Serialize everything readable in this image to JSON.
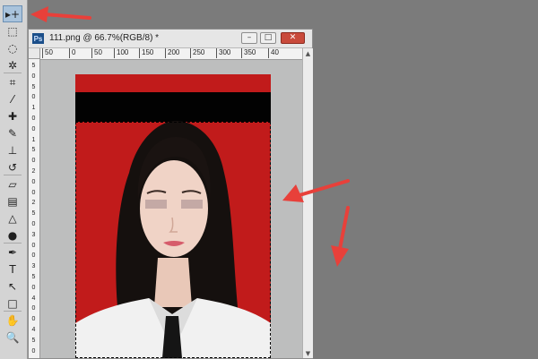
{
  "document": {
    "app_badge": "Ps",
    "title": "111.png @ 66.7%(RGB/8) *",
    "minimize_symbol": "–",
    "restore_symbol": "□",
    "close_symbol": "✕"
  },
  "rulers": {
    "top_labels": [
      "50",
      "0",
      "50",
      "100",
      "150",
      "200",
      "250",
      "300",
      "350",
      "40"
    ],
    "left_labels": [
      "5",
      "0",
      "5",
      "0",
      "1",
      "0",
      "0",
      "1",
      "5",
      "0",
      "2",
      "0",
      "0",
      "2",
      "5",
      "0",
      "3",
      "0",
      "0",
      "3",
      "5",
      "0",
      "4",
      "0",
      "0",
      "4",
      "5",
      "0"
    ]
  },
  "tools": [
    {
      "icon": "move-tool-icon",
      "glyph": "▸+",
      "active": true
    },
    {
      "icon": "marquee-tool-icon",
      "glyph": "⬚"
    },
    {
      "icon": "lasso-tool-icon",
      "glyph": "◌"
    },
    {
      "icon": "magic-wand-tool-icon",
      "glyph": "✲"
    },
    {
      "icon": "crop-tool-icon",
      "glyph": "⌗"
    },
    {
      "icon": "eyedropper-tool-icon",
      "glyph": "⁄"
    },
    {
      "icon": "healing-brush-tool-icon",
      "glyph": "✚"
    },
    {
      "icon": "brush-tool-icon",
      "glyph": "✎"
    },
    {
      "icon": "clone-stamp-tool-icon",
      "glyph": "⊥"
    },
    {
      "icon": "history-brush-tool-icon",
      "glyph": "↺"
    },
    {
      "icon": "eraser-tool-icon",
      "glyph": "▱"
    },
    {
      "icon": "gradient-tool-icon",
      "glyph": "▤"
    },
    {
      "icon": "blur-tool-icon",
      "glyph": "△"
    },
    {
      "icon": "dodge-tool-icon",
      "glyph": "●"
    },
    {
      "icon": "pen-tool-icon",
      "glyph": "✒"
    },
    {
      "icon": "type-tool-icon",
      "glyph": "T"
    },
    {
      "icon": "path-selection-tool-icon",
      "glyph": "↖"
    },
    {
      "icon": "rectangle-tool-icon",
      "glyph": "□"
    },
    {
      "icon": "hand-tool-icon",
      "glyph": "✋"
    },
    {
      "icon": "zoom-tool-icon",
      "glyph": "🔍"
    }
  ],
  "colors": {
    "workspace": "#7b7b7b",
    "photo_background": "#c11b1b",
    "black_band": "#020202",
    "annotation_arrow": "#e8403a"
  }
}
